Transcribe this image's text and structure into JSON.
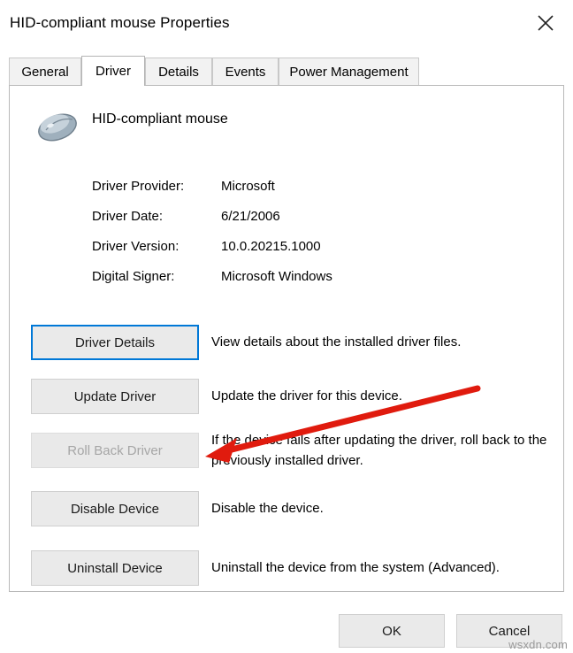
{
  "window": {
    "title": "HID-compliant mouse Properties",
    "close_icon": "close-icon"
  },
  "tabs": [
    {
      "label": "General",
      "selected": false
    },
    {
      "label": "Driver",
      "selected": true
    },
    {
      "label": "Details",
      "selected": false
    },
    {
      "label": "Events",
      "selected": false
    },
    {
      "label": "Power Management",
      "selected": false
    }
  ],
  "device": {
    "icon": "mouse-icon",
    "name": "HID-compliant mouse"
  },
  "info": [
    {
      "label": "Driver Provider:",
      "value": "Microsoft"
    },
    {
      "label": "Driver Date:",
      "value": "6/21/2006"
    },
    {
      "label": "Driver Version:",
      "value": "10.0.20215.1000"
    },
    {
      "label": "Digital Signer:",
      "value": "Microsoft Windows"
    }
  ],
  "actions": [
    {
      "button": "Driver Details",
      "description": "View details about the installed driver files.",
      "state": "focused"
    },
    {
      "button": "Update Driver",
      "description": "Update the driver for this device.",
      "state": "normal"
    },
    {
      "button": "Roll Back Driver",
      "description": "If the device fails after updating the driver, roll back to the previously installed driver.",
      "state": "disabled"
    },
    {
      "button": "Disable Device",
      "description": "Disable the device.",
      "state": "normal"
    },
    {
      "button": "Uninstall Device",
      "description": "Uninstall the device from the system (Advanced).",
      "state": "normal"
    }
  ],
  "footer": {
    "ok_label": "OK",
    "cancel_label": "Cancel"
  },
  "annotation": {
    "arrow_color": "#e01b0e",
    "name": "red-arrow-annotation"
  },
  "watermark": "wsxdn.com"
}
